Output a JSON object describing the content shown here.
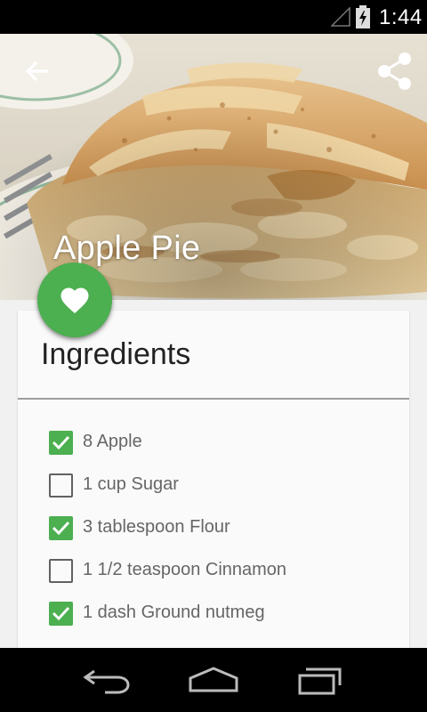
{
  "status_bar": {
    "time": "1:44",
    "icons": [
      "signal-icon",
      "battery-charging-icon"
    ]
  },
  "header": {
    "title": "Apple Pie",
    "back_icon": "arrow-back-icon",
    "share_icon": "share-icon",
    "favorite_icon": "heart-icon"
  },
  "card": {
    "title": "Ingredients",
    "ingredients": [
      {
        "text": "8 Apple",
        "checked": true
      },
      {
        "text": "1 cup Sugar",
        "checked": false
      },
      {
        "text": "3 tablespoon Flour",
        "checked": true
      },
      {
        "text": "1 1/2 teaspoon Cinnamon",
        "checked": false
      },
      {
        "text": "1 dash Ground nutmeg",
        "checked": true
      }
    ]
  },
  "nav_bar": {
    "icons": [
      "nav-back-icon",
      "nav-home-icon",
      "nav-recents-icon"
    ]
  },
  "colors": {
    "accent": "#4caf50",
    "card_background": "#fafafa",
    "page_background": "#f1f1f1"
  }
}
